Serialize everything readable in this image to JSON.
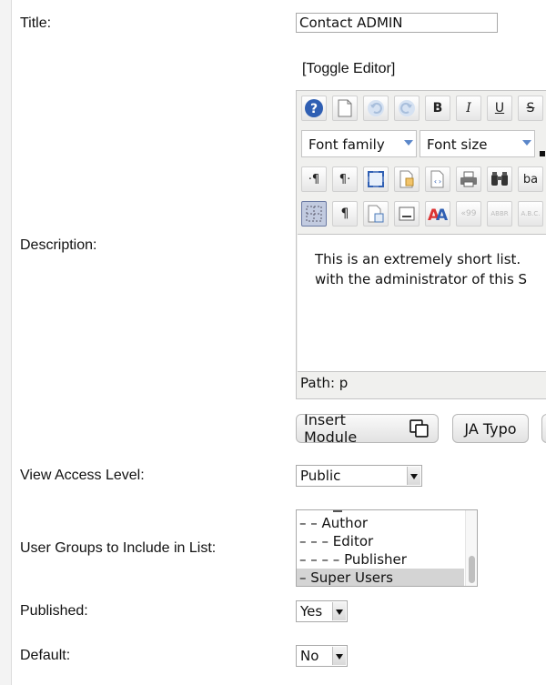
{
  "form": {
    "title_label": "Title:",
    "title_value": "Contact ADMIN",
    "description_label": "Description:",
    "toggle_editor": "[Toggle Editor]",
    "editor": {
      "font_family": "Font family",
      "font_size": "Font size",
      "content_line1": "This is an extremely short list. ",
      "content_line2": "with the administrator of this S",
      "path_label": "Path:",
      "path_value": "p",
      "buttons": {
        "bold": "B",
        "italic": "I",
        "underline": "U",
        "strike": "S",
        "ltr": "·¶",
        "rtl": "¶·",
        "pilcrow": "¶",
        "abbr": "ABBR",
        "acronym": "A.B.C.",
        "quote": "«99",
        "replace": "ba"
      }
    },
    "insert_module": "Insert Module",
    "ja_typo": "JA Typo",
    "access_label": "View Access Level:",
    "access_value": "Public",
    "groups_label": "User Groups to Include in List:",
    "groups_options": [
      "– – Author",
      "– – – Editor",
      "– – – – Publisher",
      "– Super Users"
    ],
    "published_label": "Published:",
    "published_value": "Yes",
    "default_label": "Default:",
    "default_value": "No"
  },
  "colors": {
    "accent": "#5b87c9",
    "selected_row": "#d4d4d4"
  }
}
